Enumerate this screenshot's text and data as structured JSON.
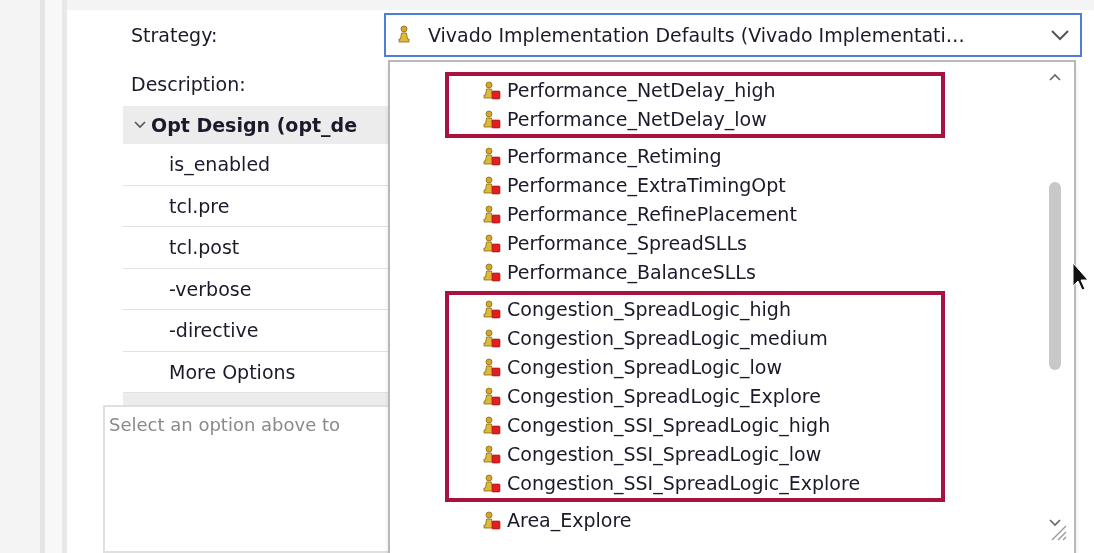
{
  "strategy": {
    "label": "Strategy:",
    "value": "Vivado Implementation Defaults (Vivado Implementati…"
  },
  "description": {
    "label": "Description:"
  },
  "options_table": {
    "group": {
      "label": "Opt Design (opt_de",
      "expanded": true
    },
    "rows": [
      "is_enabled",
      "tcl.pre",
      "tcl.post",
      "-verbose",
      "-directive",
      "More Options"
    ]
  },
  "help_text": "Select an option above to",
  "dropdown": {
    "items": [
      {
        "label": "Performance_NetDelay_high",
        "highlighted": true
      },
      {
        "label": "Performance_NetDelay_low",
        "highlighted": true
      },
      {
        "label": "Performance_Retiming",
        "highlighted": false
      },
      {
        "label": "Performance_ExtraTimingOpt",
        "highlighted": false
      },
      {
        "label": "Performance_RefinePlacement",
        "highlighted": false
      },
      {
        "label": "Performance_SpreadSLLs",
        "highlighted": false
      },
      {
        "label": "Performance_BalanceSLLs",
        "highlighted": false
      },
      {
        "label": "Congestion_SpreadLogic_high",
        "highlighted": true
      },
      {
        "label": "Congestion_SpreadLogic_medium",
        "highlighted": true
      },
      {
        "label": "Congestion_SpreadLogic_low",
        "highlighted": true
      },
      {
        "label": "Congestion_SpreadLogic_Explore",
        "highlighted": true
      },
      {
        "label": "Congestion_SSI_SpreadLogic_high",
        "highlighted": true
      },
      {
        "label": "Congestion_SSI_SpreadLogic_low",
        "highlighted": true
      },
      {
        "label": "Congestion_SSI_SpreadLogic_Explore",
        "highlighted": true
      },
      {
        "label": "Area_Explore",
        "highlighted": false
      }
    ]
  }
}
